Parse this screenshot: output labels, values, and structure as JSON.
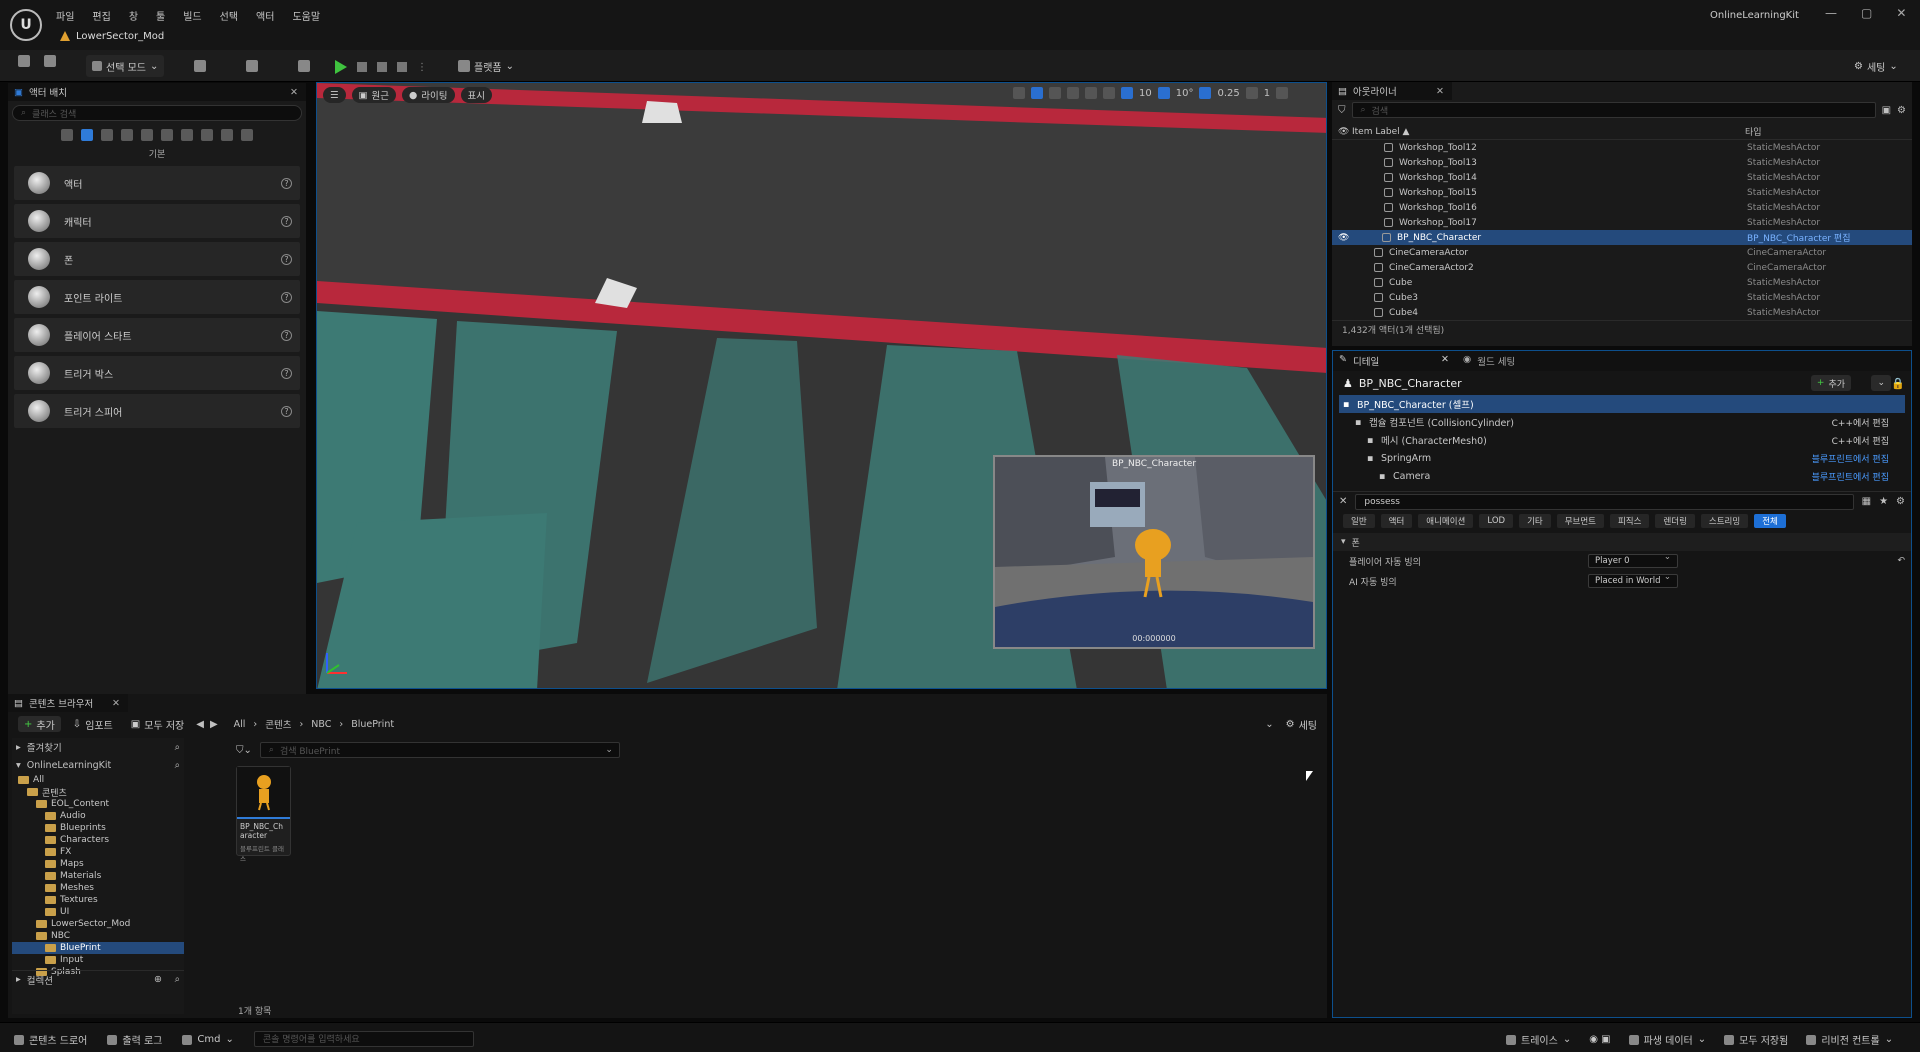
{
  "titlebar": {
    "menu": [
      "파일",
      "편집",
      "창",
      "툴",
      "빌드",
      "선택",
      "액터",
      "도움말"
    ],
    "level_tab": "LowerSector_Mod",
    "app_title": "OnlineLearningKit"
  },
  "toolbar": {
    "select_mode": "선택 모드",
    "platforms": "플랫폼",
    "settings": "세팅"
  },
  "place_actors": {
    "tab": "액터 배치",
    "search_placeholder": "클래스 검색",
    "category": "기본",
    "items": [
      "액터",
      "캐릭터",
      "폰",
      "포인트 라이트",
      "플레이어 스타트",
      "트리거 박스",
      "트리거 스피어"
    ]
  },
  "viewport": {
    "perspective": "원근",
    "lit": "라이팅",
    "show": "표시",
    "grid_snap": "10",
    "rot_snap": "10°",
    "scale_snap": "0.25",
    "camera_speed": "1",
    "pip_title": "BP_NBC_Character",
    "pip_time": "00:000000"
  },
  "outliner": {
    "tab": "아웃라이너",
    "search_placeholder": "검색",
    "col_label": "Item Label ▲",
    "col_type": "타입",
    "rows": [
      {
        "label": "Workshop_Tool12",
        "type": "StaticMeshActor"
      },
      {
        "label": "Workshop_Tool13",
        "type": "StaticMeshActor"
      },
      {
        "label": "Workshop_Tool14",
        "type": "StaticMeshActor"
      },
      {
        "label": "Workshop_Tool15",
        "type": "StaticMeshActor"
      },
      {
        "label": "Workshop_Tool16",
        "type": "StaticMeshActor"
      },
      {
        "label": "Workshop_Tool17",
        "type": "StaticMeshActor"
      },
      {
        "label": "BP_NBC_Character",
        "type": "BP_NBC_Character 편집"
      },
      {
        "label": "CineCameraActor",
        "type": "CineCameraActor"
      },
      {
        "label": "CineCameraActor2",
        "type": "CineCameraActor"
      },
      {
        "label": "Cube",
        "type": "StaticMeshActor"
      },
      {
        "label": "Cube3",
        "type": "StaticMeshActor"
      },
      {
        "label": "Cube4",
        "type": "StaticMeshActor"
      }
    ],
    "footer": "1,432개 액터(1개 선택됨)"
  },
  "details": {
    "tab": "디테일",
    "tab2": "월드 세팅",
    "actor_name": "BP_NBC_Character",
    "add": "추가",
    "components": [
      {
        "label": "BP_NBC_Character (셀프)",
        "edit": ""
      },
      {
        "label": "캡슐 컴포넌트 (CollisionCylinder)",
        "edit": "C++에서 편집"
      },
      {
        "label": "메시 (CharacterMesh0)",
        "edit": "C++에서 편집"
      },
      {
        "label": "SpringArm",
        "edit": "블루프린트에서 편집"
      },
      {
        "label": "Camera",
        "edit": "블루프린트에서 편집"
      }
    ],
    "search_value": "possess",
    "filters": [
      "일반",
      "액터",
      "애니메이션",
      "LOD",
      "기타",
      "무브먼트",
      "피직스",
      "렌더링",
      "스트리밍",
      "전체"
    ],
    "section": "폰",
    "props": [
      {
        "label": "플레이어 자동 빙의",
        "value": "Player 0"
      },
      {
        "label": "AI 자동 빙의",
        "value": "Placed in World"
      }
    ]
  },
  "content_browser": {
    "tab": "콘텐츠 브라우저",
    "add": "추가",
    "import": "임포트",
    "save_all": "모두 저장",
    "path": [
      "All",
      "콘텐츠",
      "NBC",
      "BluePrint"
    ],
    "settings": "세팅",
    "favorites": "즐겨찾기",
    "project": "OnlineLearningKit",
    "search_placeholder": "검색 BluePrint",
    "tree": [
      {
        "label": "All",
        "depth": 0
      },
      {
        "label": "콘텐츠",
        "depth": 1
      },
      {
        "label": "EOL_Content",
        "depth": 2
      },
      {
        "label": "Audio",
        "depth": 3
      },
      {
        "label": "Blueprints",
        "depth": 3
      },
      {
        "label": "Characters",
        "depth": 3
      },
      {
        "label": "FX",
        "depth": 3
      },
      {
        "label": "Maps",
        "depth": 3
      },
      {
        "label": "Materials",
        "depth": 3
      },
      {
        "label": "Meshes",
        "depth": 3
      },
      {
        "label": "Textures",
        "depth": 3
      },
      {
        "label": "UI",
        "depth": 3
      },
      {
        "label": "LowerSector_Mod",
        "depth": 2
      },
      {
        "label": "NBC",
        "depth": 2
      },
      {
        "label": "BluePrint",
        "depth": 3
      },
      {
        "label": "Input",
        "depth": 3
      },
      {
        "label": "Splash",
        "depth": 2
      }
    ],
    "collections": "컬렉션",
    "asset_name": "BP_NBC_Character",
    "asset_type": "블루프린트 클래스",
    "item_count": "1개 항목"
  },
  "statusbar": {
    "content_drawer": "콘텐츠 드로어",
    "output_log": "출력 로그",
    "cmd": "Cmd",
    "console_placeholder": "콘솔 명령어를 입력하세요",
    "trace": "트레이스",
    "derived_data": "파생 데이터",
    "all_saved": "모두 저장됨",
    "source_control": "리비전 컨트롤"
  }
}
